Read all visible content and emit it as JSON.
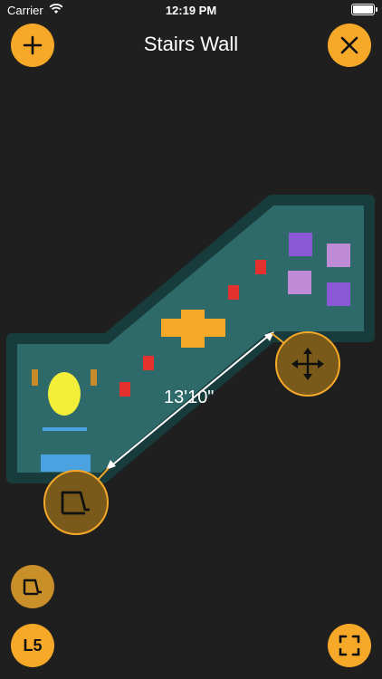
{
  "status_bar": {
    "carrier": "Carrier",
    "time": "12:19 PM"
  },
  "header": {
    "title": "Stairs Wall",
    "add_icon": "plus-icon",
    "close_icon": "close-icon"
  },
  "plan": {
    "measurement": "13'10\"",
    "colors": {
      "floor": "#2e6a69",
      "border": "#183b3b",
      "handle": "#f6a829",
      "handle_fill": "#7a5a1a"
    }
  },
  "bottom": {
    "level_label": "L5",
    "tool_icon": "corner-tool-icon",
    "expand_icon": "fullscreen-icon"
  }
}
